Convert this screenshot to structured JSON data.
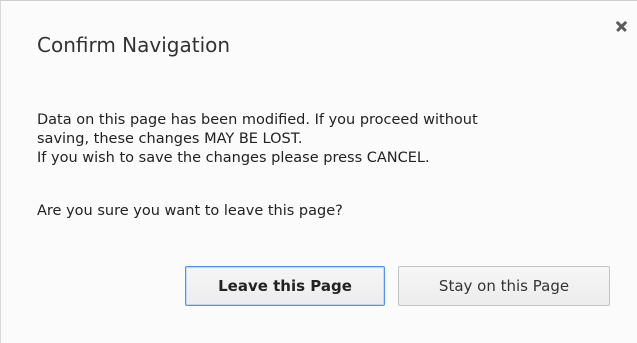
{
  "dialog": {
    "title": "Confirm Navigation",
    "close_icon": "close-icon",
    "message_lines": [
      "Data on this page has been modified.  If you proceed without",
      "saving, these changes MAY BE LOST.",
      "If you wish to save the changes please press CANCEL."
    ],
    "question": "Are you sure you want to leave this page?",
    "buttons": {
      "leave_label": "Leave this Page",
      "stay_label": "Stay on this Page"
    },
    "colors": {
      "focus_border": "#4d90fe"
    }
  }
}
